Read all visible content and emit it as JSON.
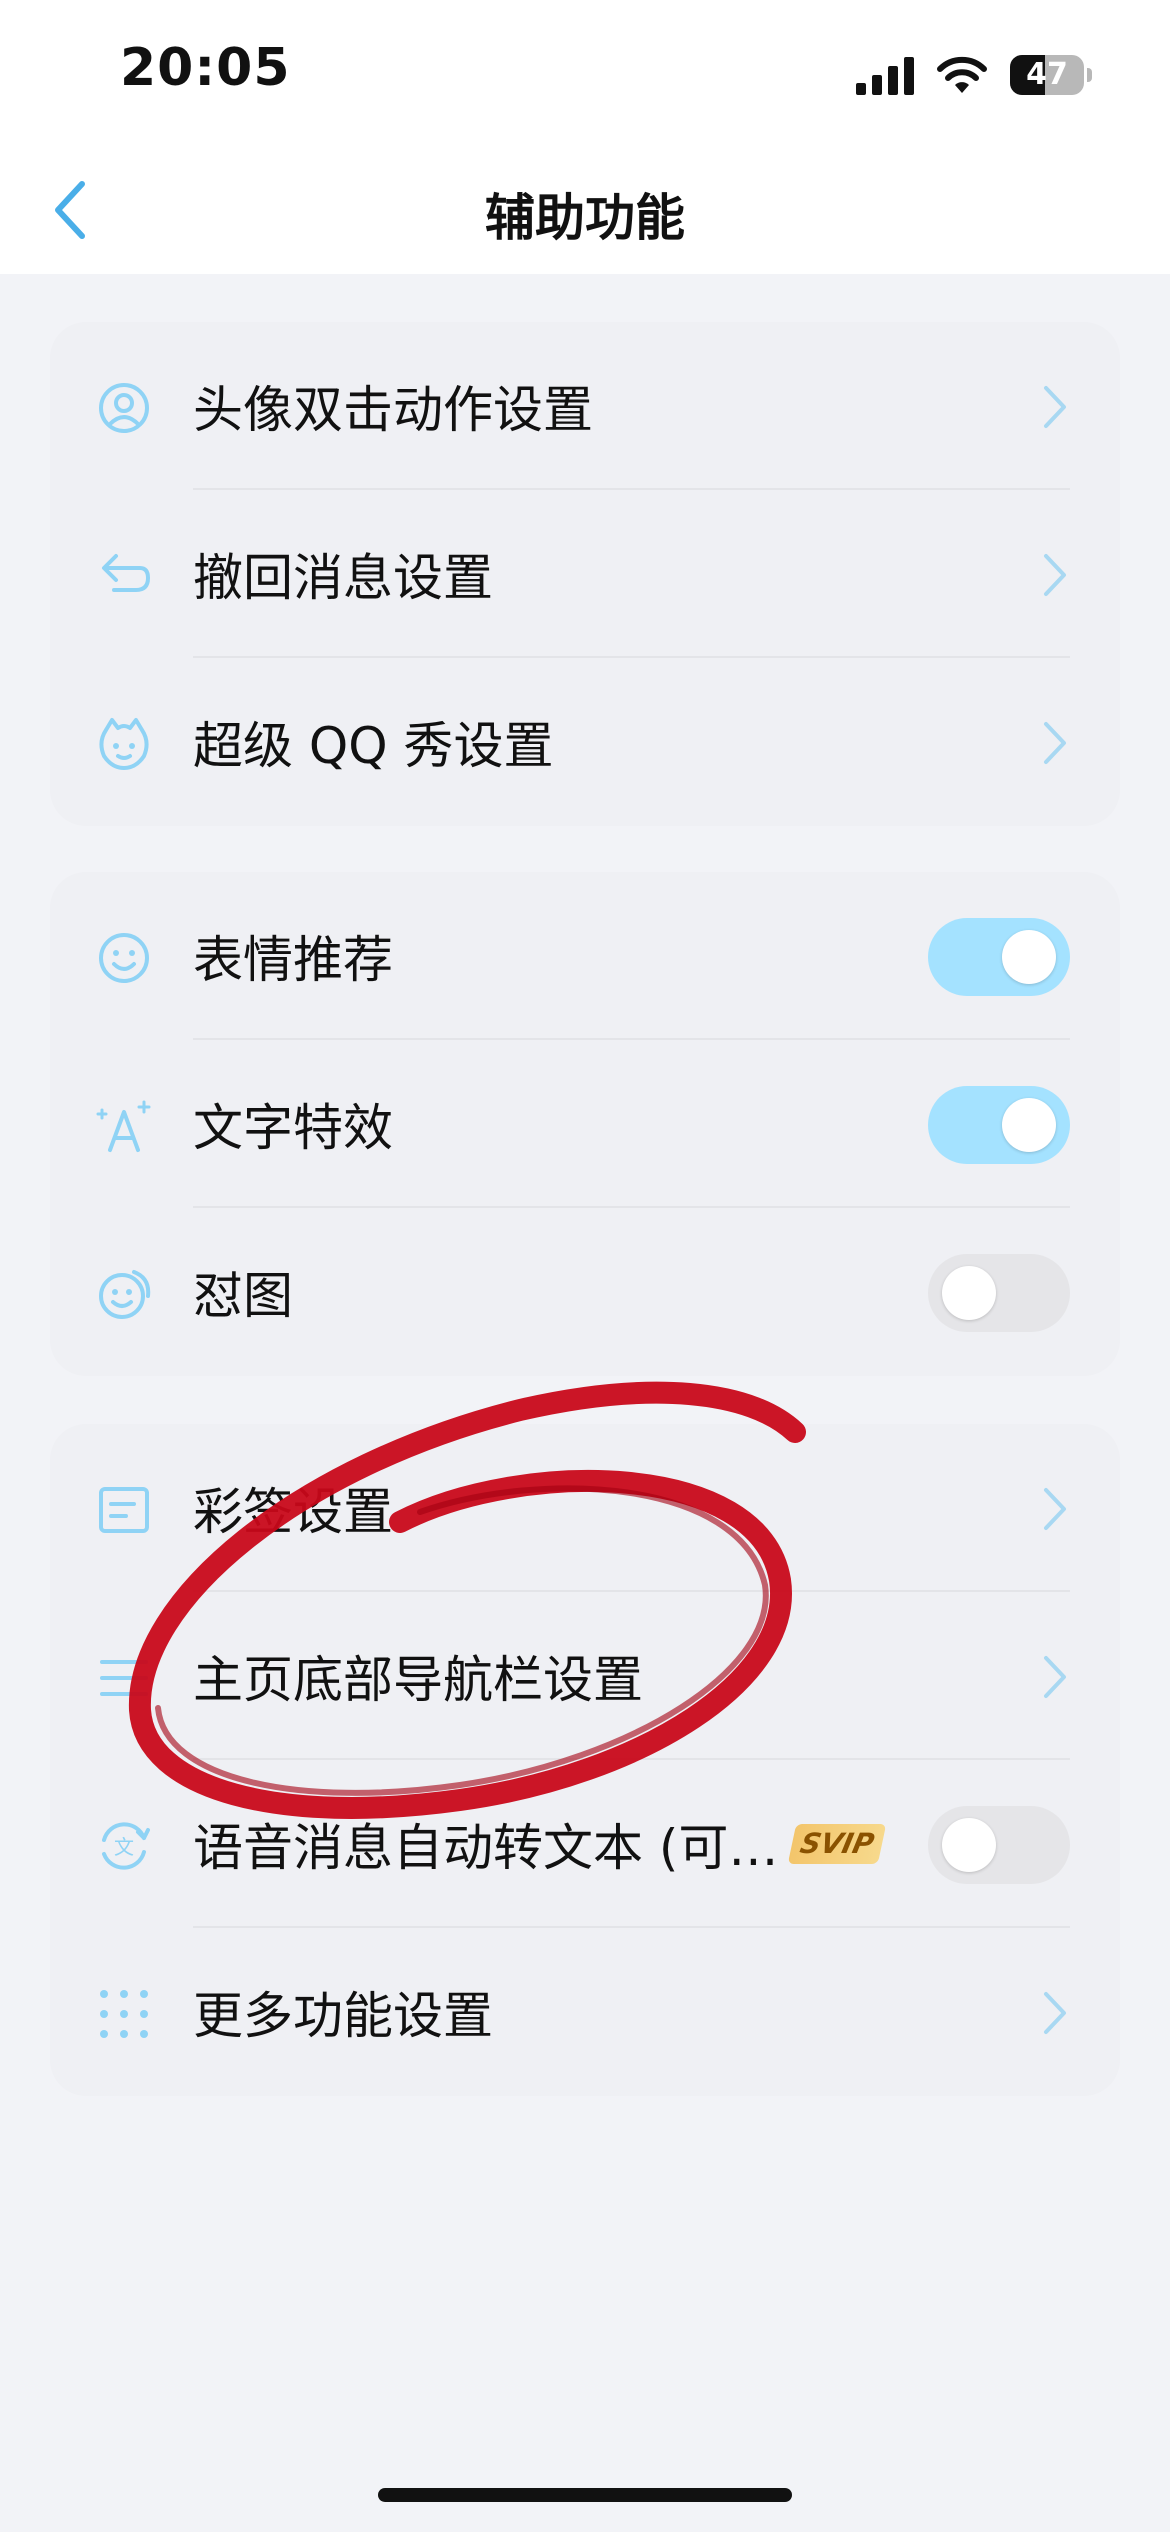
{
  "status_bar": {
    "time": "20:05",
    "battery_level": "47",
    "battery_fraction": 0.47,
    "icons": [
      "signal-icon",
      "wifi-icon",
      "battery-icon"
    ]
  },
  "nav": {
    "title": "辅助功能",
    "back_icon": "back-chevron-icon"
  },
  "colors": {
    "accent": "#4aaee8",
    "icon": "#8fd3f5",
    "toggle_on": "#a4e2ff",
    "toggle_off": "#e5e5e8",
    "annotation": "#c8081a"
  },
  "groups": [
    {
      "rows": [
        {
          "label": "头像双击动作设置",
          "icon": "avatar-icon",
          "control": "chevron"
        },
        {
          "label": "撤回消息设置",
          "icon": "undo-icon",
          "control": "chevron"
        },
        {
          "label": "超级 QQ 秀设置",
          "icon": "qq-show-icon",
          "control": "chevron"
        }
      ]
    },
    {
      "rows": [
        {
          "label": "表情推荐",
          "icon": "emoji-icon",
          "control": "toggle",
          "on": true
        },
        {
          "label": "文字特效",
          "icon": "text-effect-icon",
          "control": "toggle",
          "on": true
        },
        {
          "label": "怼图",
          "icon": "sticker-icon",
          "control": "toggle",
          "on": false
        }
      ]
    },
    {
      "rows": [
        {
          "label": "彩签设置",
          "icon": "tag-icon",
          "control": "chevron"
        },
        {
          "label": "主页底部导航栏设置",
          "icon": "menu-icon",
          "control": "chevron"
        },
        {
          "label": "语音消息自动转文本 (可…",
          "icon": "voice-text-icon",
          "control": "toggle",
          "on": false,
          "badge": "SVIP"
        },
        {
          "label": "更多功能设置",
          "icon": "grid-icon",
          "control": "chevron"
        }
      ]
    }
  ]
}
